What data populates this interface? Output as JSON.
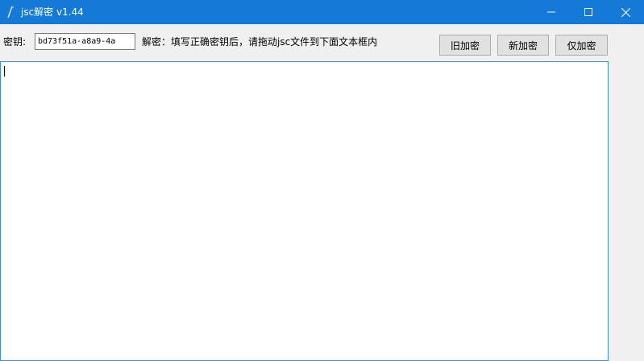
{
  "window": {
    "title": "jsc解密 v1.44",
    "title_bar_color": "#1479d7",
    "icons": {
      "app": "app-icon",
      "minimize": "minimize-icon",
      "maximize": "maximize-icon",
      "close": "close-icon"
    }
  },
  "toolbar": {
    "key_label": "密钥:",
    "key_value": "bd73f51a-a8a9-4a",
    "hint": "解密：填写正确密钥后，请拖动jsc文件到下面文本框内",
    "buttons": {
      "old_encrypt": "旧加密",
      "new_encrypt": "新加密",
      "encrypt_only": "仅加密"
    }
  },
  "main": {
    "text_content": ""
  }
}
